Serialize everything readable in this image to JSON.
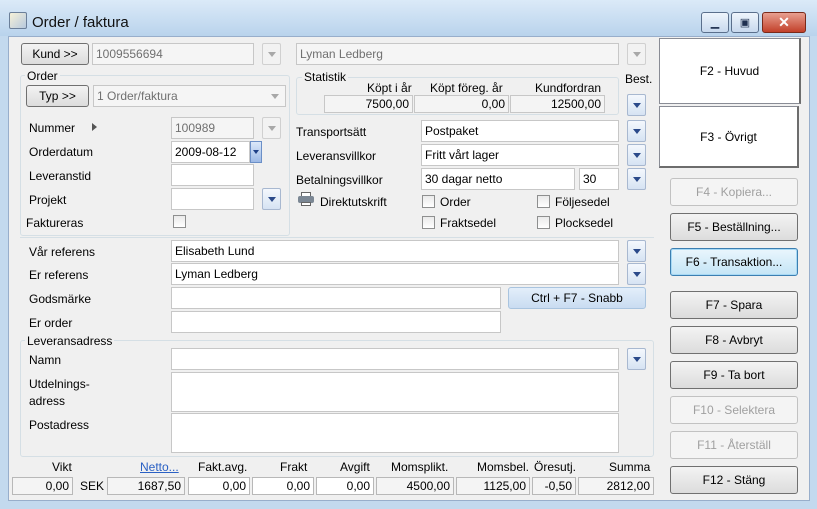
{
  "window": {
    "title": "Order / faktura",
    "minimize": "▁",
    "maximize": "▣",
    "close": "✕"
  },
  "customer": {
    "button": "Kund >>",
    "number": "1009556694",
    "name": "Lyman Ledberg"
  },
  "order": {
    "group": "Order",
    "type_button": "Typ >>",
    "type_value": "1  Order/faktura",
    "number_label": "Nummer",
    "number_value": "100989",
    "date_label": "Orderdatum",
    "date_value": "2009-08-12",
    "delivery_time_label": "Leveranstid",
    "delivery_time_value": "",
    "project_label": "Projekt",
    "project_value": "",
    "invoiced_label": "Faktureras"
  },
  "statistics": {
    "group": "Statistik",
    "col1": "Köpt i år",
    "col2": "Köpt föreg. år",
    "col3": "Kundfordran",
    "val1": "7500,00",
    "val2": "0,00",
    "val3": "12500,00",
    "best": "Best."
  },
  "terms": {
    "transport_label": "Transportsätt",
    "transport_value": "Postpaket",
    "delivery_terms_label": "Leveransvillkor",
    "delivery_terms_value": "Fritt vårt lager",
    "payment_label": "Betalningsvillkor",
    "payment_value": "30 dagar netto",
    "payment_days": "30"
  },
  "print": {
    "direct_label": "Direktutskrift",
    "order": "Order",
    "following": "Följesedel",
    "freight": "Fraktsedel",
    "picking": "Plocksedel"
  },
  "refs": {
    "our_ref_label": "Vår referens",
    "our_ref_value": "Elisabeth Lund",
    "your_ref_label": "Er referens",
    "your_ref_value": "Lyman Ledberg",
    "goods_mark_label": "Godsmärke",
    "goods_mark_value": "",
    "your_order_label": "Er order",
    "your_order_value": "",
    "quick_button": "Ctrl + F7 - Snabb"
  },
  "delivery": {
    "group": "Leveransadress",
    "name_label": "Namn",
    "name_value": "",
    "dist_label_1": "Utdelnings-",
    "dist_label_2": "adress",
    "post_label": "Postadress"
  },
  "totals": {
    "weight_h": "Vikt",
    "netto_h": "Netto...",
    "fee_h": "Fakt.avg.",
    "freight_h": "Frakt",
    "charge_h": "Avgift",
    "vat_liable_h": "Momsplikt.",
    "vat_amount_h": "Momsbel.",
    "rounding_h": "Öresutj.",
    "sum_h": "Summa",
    "weight": "0,00",
    "currency": "SEK",
    "netto": "1687,50",
    "fee": "0,00",
    "freight": "0,00",
    "charge": "0,00",
    "vat_liable": "4500,00",
    "vat_amount": "1125,00",
    "rounding": "-0,50",
    "sum": "2812,00"
  },
  "side": {
    "tab_main": "F2 - Huvud",
    "tab_other": "F3 - Övrigt",
    "copy": "F4 - Kopiera...",
    "order_btn": "F5 - Beställning...",
    "transaction": "F6 - Transaktion...",
    "save": "F7 - Spara",
    "cancel": "F8 - Avbryt",
    "delete": "F9 - Ta bort",
    "select": "F10 - Selektera",
    "restore": "F11 - Återställ",
    "close": "F12 - Stäng"
  }
}
